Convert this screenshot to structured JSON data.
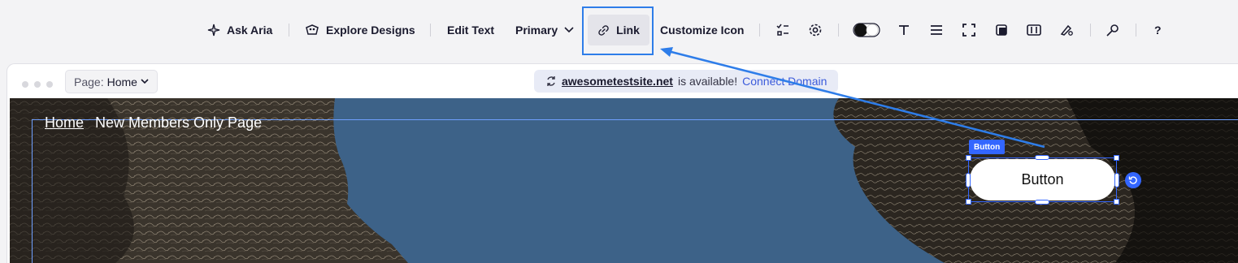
{
  "toolbar": {
    "ask_aria": "Ask Aria",
    "explore_designs": "Explore Designs",
    "edit_text": "Edit Text",
    "primary": "Primary",
    "link": "Link",
    "customize_icon": "Customize Icon",
    "help": "?"
  },
  "browser": {
    "page_label": "Page:",
    "page_value": "Home",
    "domain": "awesometestsite.net",
    "domain_status": "is available!",
    "connect_domain": "Connect Domain"
  },
  "canvas": {
    "nav": [
      "Home",
      "New Members Only Page"
    ],
    "selection_label": "Button",
    "button_text": "Button"
  },
  "colors": {
    "accent": "#3366ff",
    "annotation": "#2e7de9",
    "sky": "#3d6288"
  }
}
